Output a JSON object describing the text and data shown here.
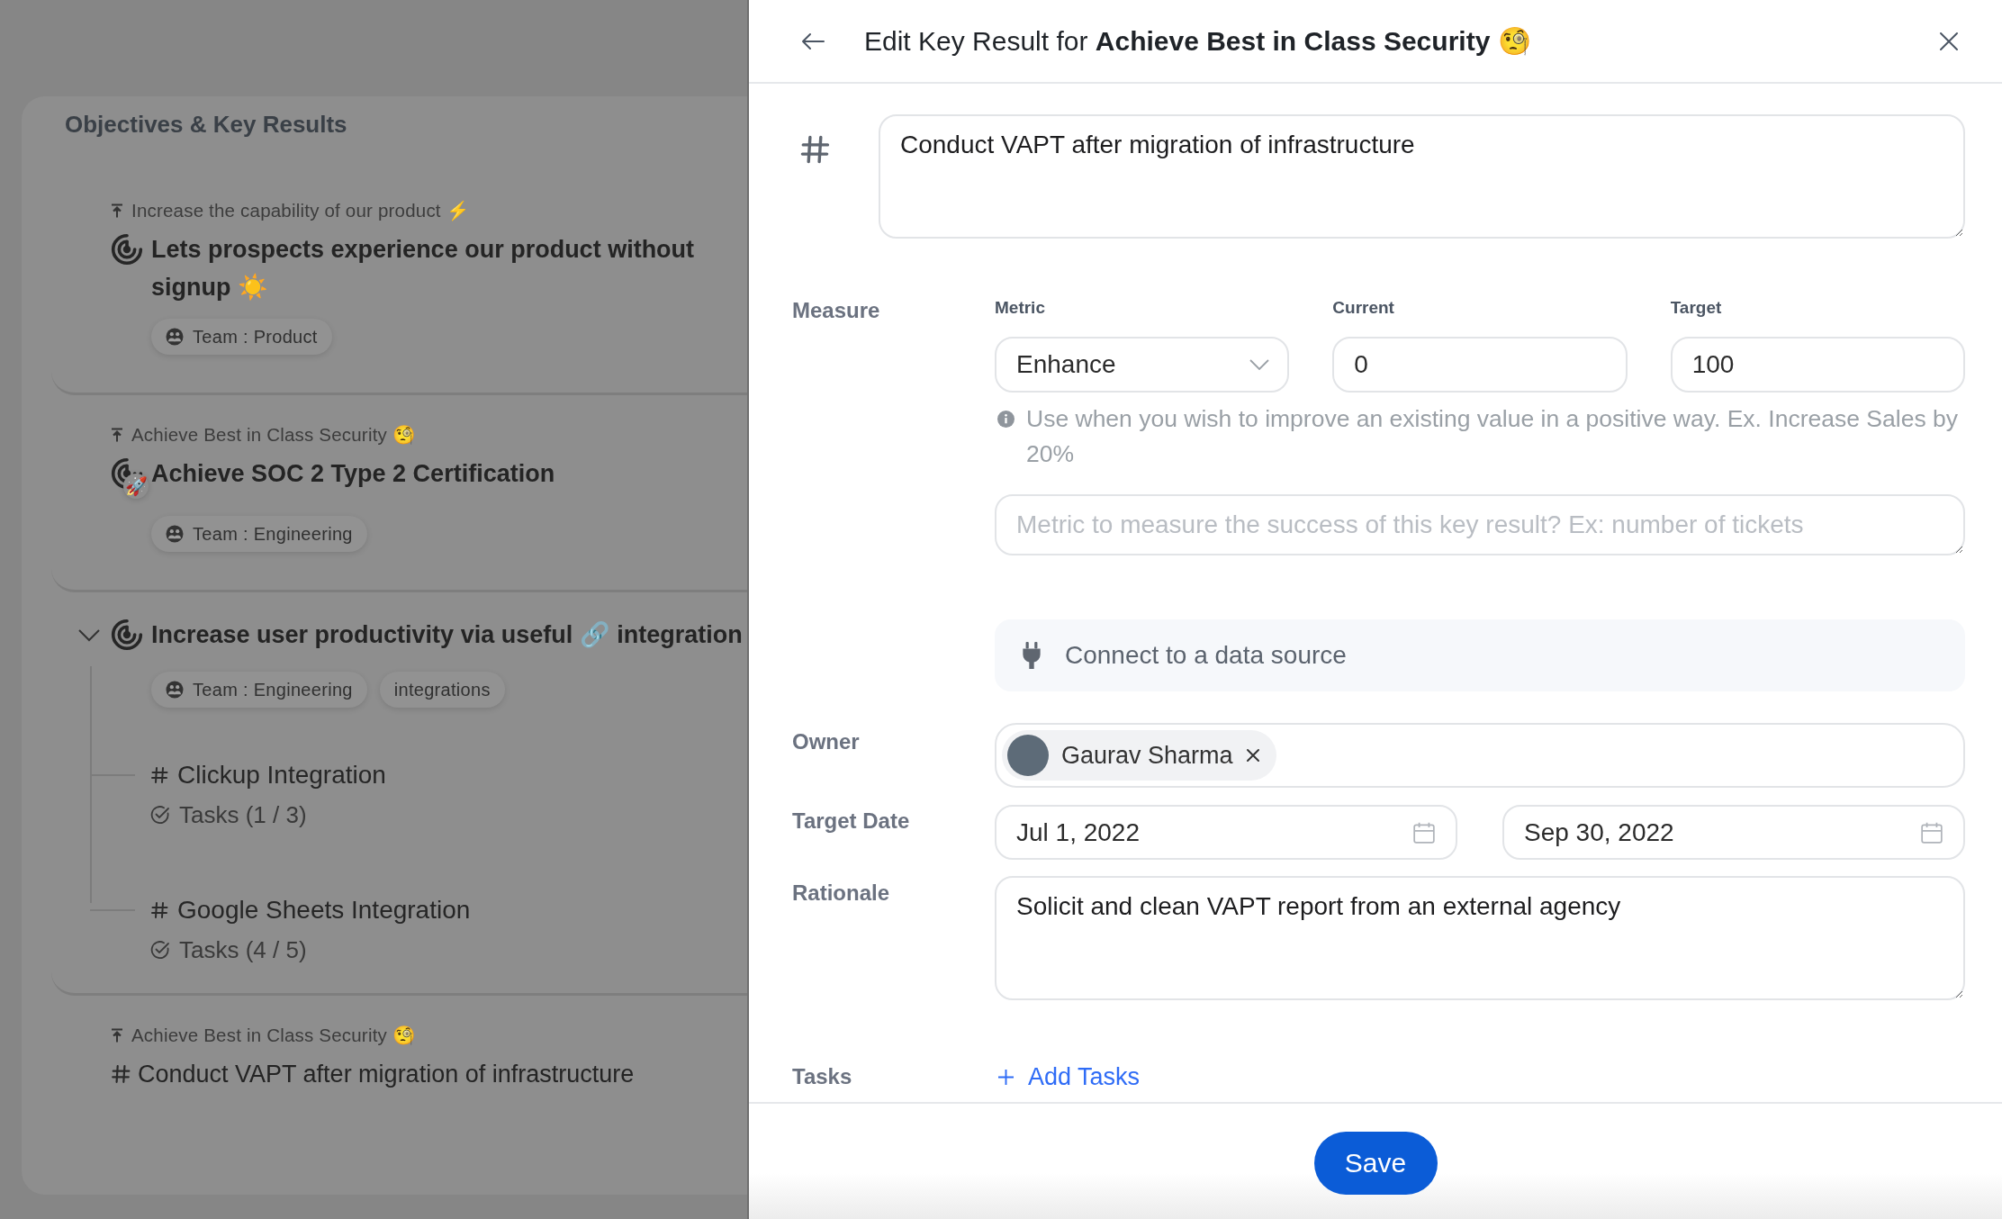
{
  "okr": {
    "title": "Objectives & Key Results",
    "items": [
      {
        "kind": "objective",
        "parent": "Increase the capability of our product ⚡",
        "title": "Lets prospects experience our product without signup ☀️",
        "tags": [
          {
            "kind": "team",
            "label": "Team : Product"
          }
        ]
      },
      {
        "kind": "objective",
        "parent": "Achieve Best in Class Security 🧐",
        "title": "Achieve SOC 2 Type 2 Certification",
        "badge": "🚀",
        "tags": [
          {
            "kind": "team",
            "label": "Team : Engineering"
          }
        ]
      },
      {
        "kind": "objective",
        "expanded": true,
        "title": "Increase user productivity via useful 🔗 integration",
        "tags": [
          {
            "kind": "team",
            "label": "Team : Engineering"
          },
          {
            "kind": "label",
            "label": "integrations"
          }
        ],
        "children": [
          {
            "kind": "key_result",
            "title": "Clickup Integration",
            "tasks": "Tasks (1 / 3)"
          },
          {
            "kind": "key_result",
            "title": "Google Sheets Integration",
            "tasks": "Tasks (4 / 5)"
          }
        ]
      },
      {
        "kind": "key_result",
        "parent": "Achieve Best in Class Security 🧐",
        "title": "Conduct VAPT after migration of infrastructure"
      }
    ]
  },
  "drawer": {
    "title": "Edit Key Result for **Achieve Best in Class Security** 🧐",
    "name_field": {
      "value": "Conduct VAPT after migration of infrastructure"
    },
    "measure": {
      "label": "Measure",
      "metric": {
        "label": "Metric",
        "value": "Enhance"
      },
      "current": {
        "label": "Current",
        "value": "0"
      },
      "target": {
        "label": "Target",
        "value": "100"
      },
      "hint": "Use when you wish to improve an existing value in a positive way. Ex. Increase Sales by 20%",
      "description": {
        "placeholder": "Metric to measure the success of this key result? Ex: number of tickets"
      },
      "data_source": "Connect to a data source"
    },
    "owner": {
      "label": "Owner",
      "people": [
        {
          "name": "Gaurav Sharma"
        }
      ]
    },
    "target_date": {
      "label": "Target Date",
      "start": "Jul 1, 2022",
      "end": "Sep 30, 2022"
    },
    "rationale": {
      "label": "Rationale",
      "value": "Solicit and clean VAPT report from an external agency"
    },
    "tasks": {
      "label": "Tasks",
      "add": "Add Tasks"
    },
    "save": "Save"
  }
}
